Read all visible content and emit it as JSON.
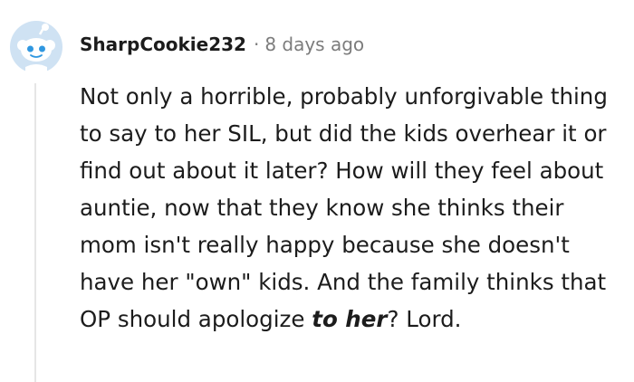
{
  "comment": {
    "author": "SharpCookie232",
    "separator": "·",
    "time": "8 days ago",
    "body_part1": "Not only a horrible, probably unforgivable thing to say to her SIL, but did the kids overhear it or find out about it later? How will they feel about auntie, now that they know she thinks their mom isn't really happy because she doesn't have her \"own\" kids. And the family thinks that OP should apologize ",
    "body_emphasis": "to her",
    "body_part2": "? Lord."
  },
  "avatar": {
    "icon": "reddit-snoo-avatar-icon",
    "bg_color": "#cfe2f3",
    "accent": "#2f97e0"
  },
  "colors": {
    "text": "#1c1c1c",
    "meta": "#7c7c7c",
    "thread_line": "#e6e6e6"
  }
}
